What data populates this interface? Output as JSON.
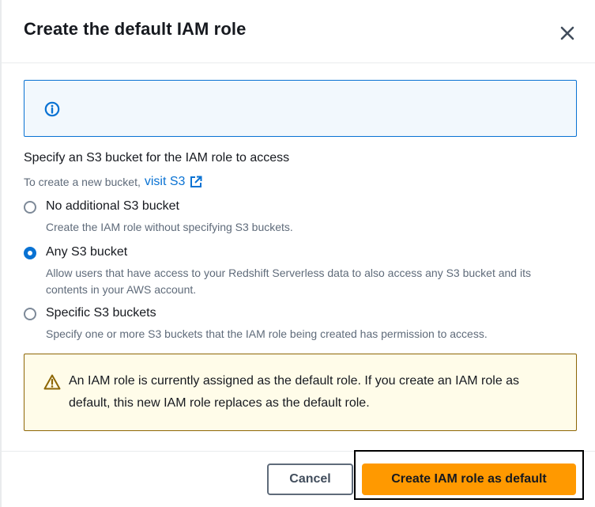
{
  "modal": {
    "title": "Create the default IAM role",
    "close_icon": "close-icon"
  },
  "info_box": {
    "icon": "info-icon",
    "text": ""
  },
  "bucket_section": {
    "label": "Specify an S3 bucket for the IAM role to access",
    "helper_prefix": "To create a new bucket,",
    "helper_link": "visit S3",
    "helper_link_icon": "external-link-icon"
  },
  "options": [
    {
      "label": "No additional S3 bucket",
      "description": "Create the IAM role without specifying S3 buckets.",
      "selected": false
    },
    {
      "label": "Any S3 bucket",
      "description": "Allow users that have access to your Redshift Serverless data to also access any S3 bucket and its contents in your AWS account.",
      "selected": true
    },
    {
      "label": "Specific S3 buckets",
      "description": "Specify one or more S3 buckets that the IAM role being created has permission to access.",
      "selected": false
    }
  ],
  "warning": {
    "icon": "warning-icon",
    "text": "An IAM role is currently assigned as the default role. If you create an IAM role as default, this new IAM role replaces as the default role."
  },
  "footer": {
    "cancel_label": "Cancel",
    "primary_label": "Create IAM role as default"
  },
  "colors": {
    "accent": "#0972d3",
    "primary_button": "#ff9900",
    "info_bg": "#f2f8fd",
    "warning_bg": "#fffce9",
    "warning_border": "#8d6605"
  }
}
